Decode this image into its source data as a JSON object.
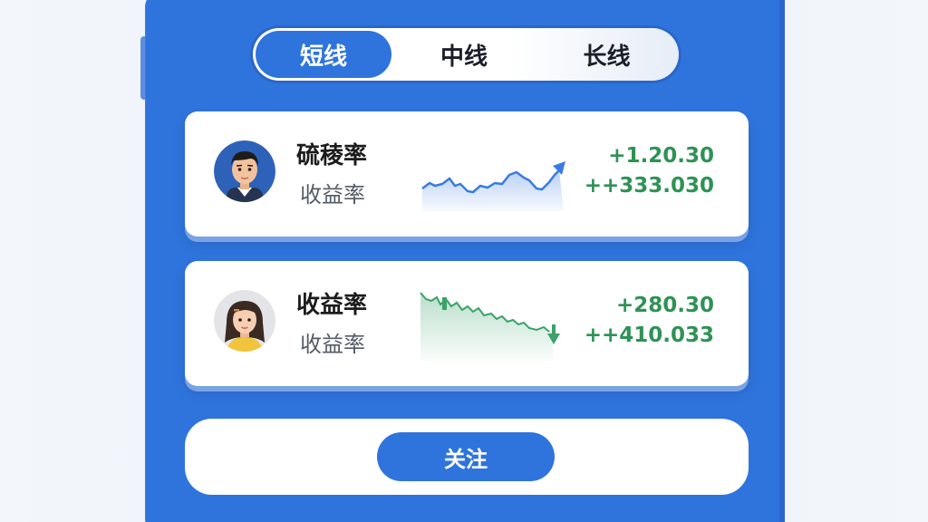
{
  "tabs": [
    {
      "label": "短线",
      "active": true
    },
    {
      "label": "中线",
      "active": false
    },
    {
      "label": "长线",
      "active": false
    }
  ],
  "traders": [
    {
      "name": "硫稜率",
      "subtitle": "收益率",
      "value1": "+1.20.30",
      "value2": "++333.030",
      "trend": "up",
      "avatar": "male-avatar-icon",
      "trend_color": "#3a7be0"
    },
    {
      "name": "收益率",
      "subtitle": "收益率",
      "value1": "+280.30",
      "value2": "++410.033",
      "trend": "down",
      "avatar": "female-avatar-icon",
      "trend_color": "#3aa36a"
    }
  ],
  "follow_button": {
    "label": "关注"
  },
  "colors": {
    "accent": "#2f74dd",
    "positive": "#2e9255"
  }
}
